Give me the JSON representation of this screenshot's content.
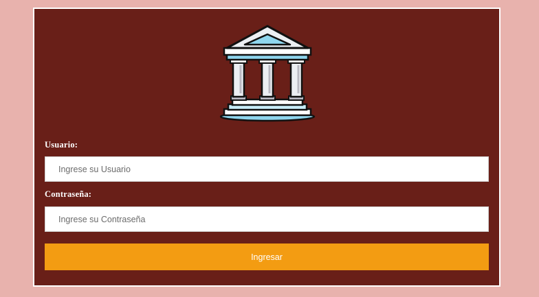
{
  "form": {
    "username": {
      "label": "Usuario:",
      "placeholder": "Ingrese su Usuario",
      "value": ""
    },
    "password": {
      "label": "Contraseña:",
      "placeholder": "Ingrese su Contraseña",
      "value": ""
    },
    "submit_label": "Ingresar"
  },
  "logo": {
    "icon": "bank-building-icon"
  },
  "colors": {
    "page_background": "#e8b2ad",
    "card_background": "#691f18",
    "button_background": "#f39c12",
    "icon_accent": "#8fd6ee"
  }
}
